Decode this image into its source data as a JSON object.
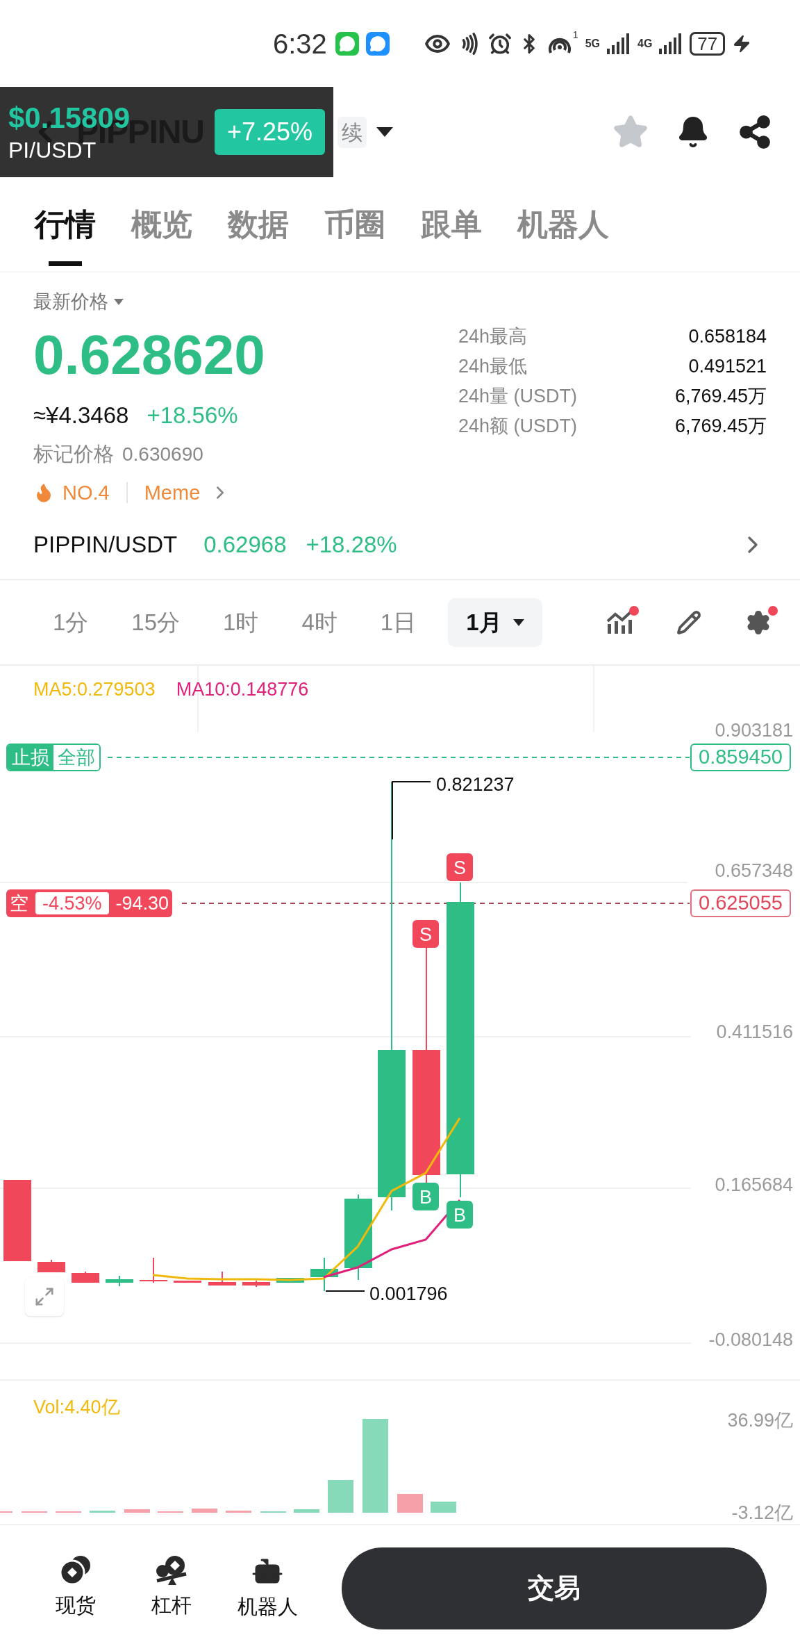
{
  "status_bar": {
    "time": "6:32",
    "sim_label": "1",
    "network_1": "5G",
    "network_2": "4G",
    "battery": "77"
  },
  "header": {
    "title": "PIPPINU",
    "chip": "续",
    "favorited": false
  },
  "overlay": {
    "price": "$0.15809",
    "pair": "PI/USDT",
    "change": "+7.25%"
  },
  "tabs": [
    {
      "label": "行情",
      "selected": true
    },
    {
      "label": "概览",
      "selected": false
    },
    {
      "label": "数据",
      "selected": false
    },
    {
      "label": "币圈",
      "selected": false
    },
    {
      "label": "跟单",
      "selected": false
    },
    {
      "label": "机器人",
      "selected": false
    }
  ],
  "price": {
    "label": "最新价格",
    "last": "0.628620",
    "cny": "≈¥4.3468",
    "change": "+18.56%",
    "mark_label": "标记价格",
    "mark": "0.630690",
    "rank": "NO.4",
    "tag": "Meme"
  },
  "stats": [
    {
      "label": "24h最高",
      "value": "0.658184"
    },
    {
      "label": "24h最低",
      "value": "0.491521"
    },
    {
      "label": "24h量 (USDT)",
      "value": "6,769.45万"
    },
    {
      "label": "24h额 (USDT)",
      "value": "6,769.45万"
    }
  ],
  "related": {
    "pair": "PIPPIN/USDT",
    "price": "0.62968",
    "change": "+18.28%"
  },
  "intervals": [
    {
      "label": "1分",
      "selected": false
    },
    {
      "label": "15分",
      "selected": false
    },
    {
      "label": "1时",
      "selected": false
    },
    {
      "label": "4时",
      "selected": false
    },
    {
      "label": "1日",
      "selected": false
    },
    {
      "label": "1月",
      "selected": true
    }
  ],
  "tools": [
    {
      "kind": "indicators",
      "dot": true
    },
    {
      "kind": "draw",
      "dot": false
    },
    {
      "kind": "settings",
      "dot": true
    }
  ],
  "chart": {
    "ma": [
      {
        "label": "MA5:0.279503",
        "color": "#f0b90b"
      },
      {
        "label": "MA10:0.148776",
        "color": "#e0207a"
      }
    ],
    "y_ticks": [
      "0.903181",
      "0.657348",
      "0.411516",
      "0.165684",
      "-0.080148"
    ],
    "stop_loss": {
      "tag": "止损",
      "scope": "全部",
      "price": "0.859450"
    },
    "position": {
      "side": "空",
      "pnl_pct": "-4.53%",
      "pnl": "-94.30",
      "price": "0.625055"
    },
    "high": "0.821237",
    "low": "0.001796",
    "markers": [
      {
        "label": "S",
        "kind": "sell"
      },
      {
        "label": "S",
        "kind": "sell"
      },
      {
        "label": "B",
        "kind": "buy"
      },
      {
        "label": "B",
        "kind": "buy"
      }
    ]
  },
  "volume": {
    "label": "Vol:4.40亿",
    "y_ticks": [
      "36.99亿",
      "-3.12亿"
    ]
  },
  "bottom_nav": [
    {
      "label": "现货",
      "kind": "spot"
    },
    {
      "label": "杠杆",
      "kind": "margin"
    },
    {
      "label": "机器人",
      "kind": "bot"
    }
  ],
  "trade_button": "交易"
}
